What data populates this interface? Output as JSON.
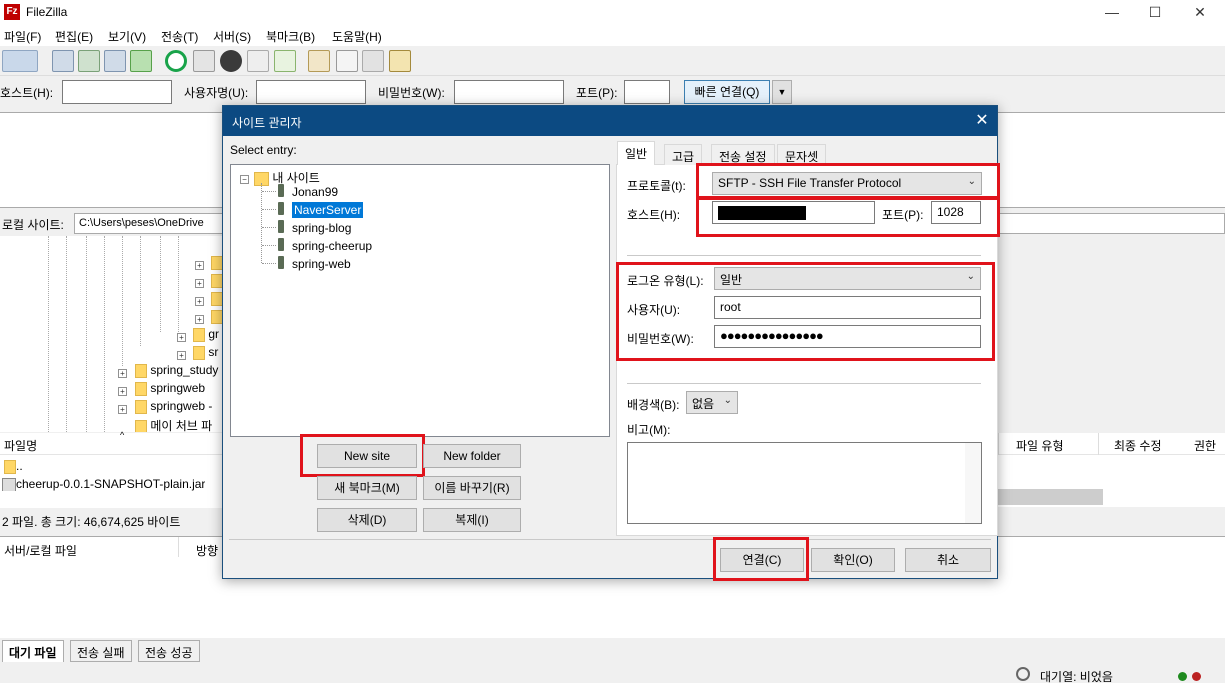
{
  "window": {
    "title": "FileZilla",
    "app_icon": "Fz",
    "minimize": "—",
    "maximize": "☐",
    "close": "✕"
  },
  "menu": [
    "파일(F)",
    "편집(E)",
    "보기(V)",
    "전송(T)",
    "서버(S)",
    "북마크(B)",
    "도움말(H)"
  ],
  "quickconnect": {
    "host_label": "호스트(H):",
    "user_label": "사용자명(U):",
    "pass_label": "비밀번호(W):",
    "port_label": "포트(P):",
    "button": "빠른 연결(Q)",
    "dropdown_icon": "▼"
  },
  "local": {
    "label": "로컬 사이트:",
    "path": "C:\\Users\\peses\\OneDrive",
    "tree": [
      {
        "label": "gr"
      },
      {
        "label": "sr"
      },
      {
        "label": "spring_study"
      },
      {
        "label": "springweb"
      },
      {
        "label": "springweb -"
      },
      {
        "label": "메이 처브 파"
      }
    ],
    "filename_header": "파일명",
    "files": [
      "..",
      "cheerup-0.0.1-SNAPSHOT-plain.jar"
    ],
    "status": "2 파일. 총 크기: 46,674,625 바이트"
  },
  "remote": {
    "headers": [
      "파일 유형",
      "최종 수정",
      "권한"
    ]
  },
  "queue": {
    "col_server_local": "서버/로컬 파일",
    "col_direction": "방향",
    "tabs": [
      "대기 파일",
      "전송 실패",
      "전송 성공"
    ],
    "status": "대기열: 비었음"
  },
  "dialog": {
    "title": "사이트 관리자",
    "close_icon": "✕",
    "select_entry": "Select entry:",
    "tree_root": "내 사이트",
    "sites": [
      "Jonan99",
      "NaverServer",
      "spring-blog",
      "spring-cheerup",
      "spring-web"
    ],
    "selected_site": "NaverServer",
    "buttons": {
      "new_site": "New site",
      "new_folder": "New folder",
      "new_bookmark": "새 북마크(M)",
      "rename": "이름 바꾸기(R)",
      "delete": "삭제(D)",
      "duplicate": "복제(I)",
      "connect": "연결(C)",
      "ok": "확인(O)",
      "cancel": "취소"
    },
    "tabs": [
      "일반",
      "고급",
      "전송 설정",
      "문자셋"
    ],
    "active_tab": "일반",
    "form": {
      "protocol_label": "프로토콜(t):",
      "protocol_value": "SFTP - SSH File Transfer Protocol",
      "host_label": "호스트(H):",
      "port_label": "포트(P):",
      "port_value": "1028",
      "logon_label": "로그온 유형(L):",
      "logon_value": "일반",
      "user_label": "사용자(U):",
      "user_value": "root",
      "pass_label": "비밀번호(W):",
      "pass_value": "●●●●●●●●●●●●●●●",
      "bgcolor_label": "배경색(B):",
      "bgcolor_value": "없음",
      "comment_label": "비고(M):"
    }
  },
  "colors": {
    "dialog_title_bg": "#0c4a82",
    "highlight_red": "#e0131b",
    "selection": "#0078d7"
  }
}
